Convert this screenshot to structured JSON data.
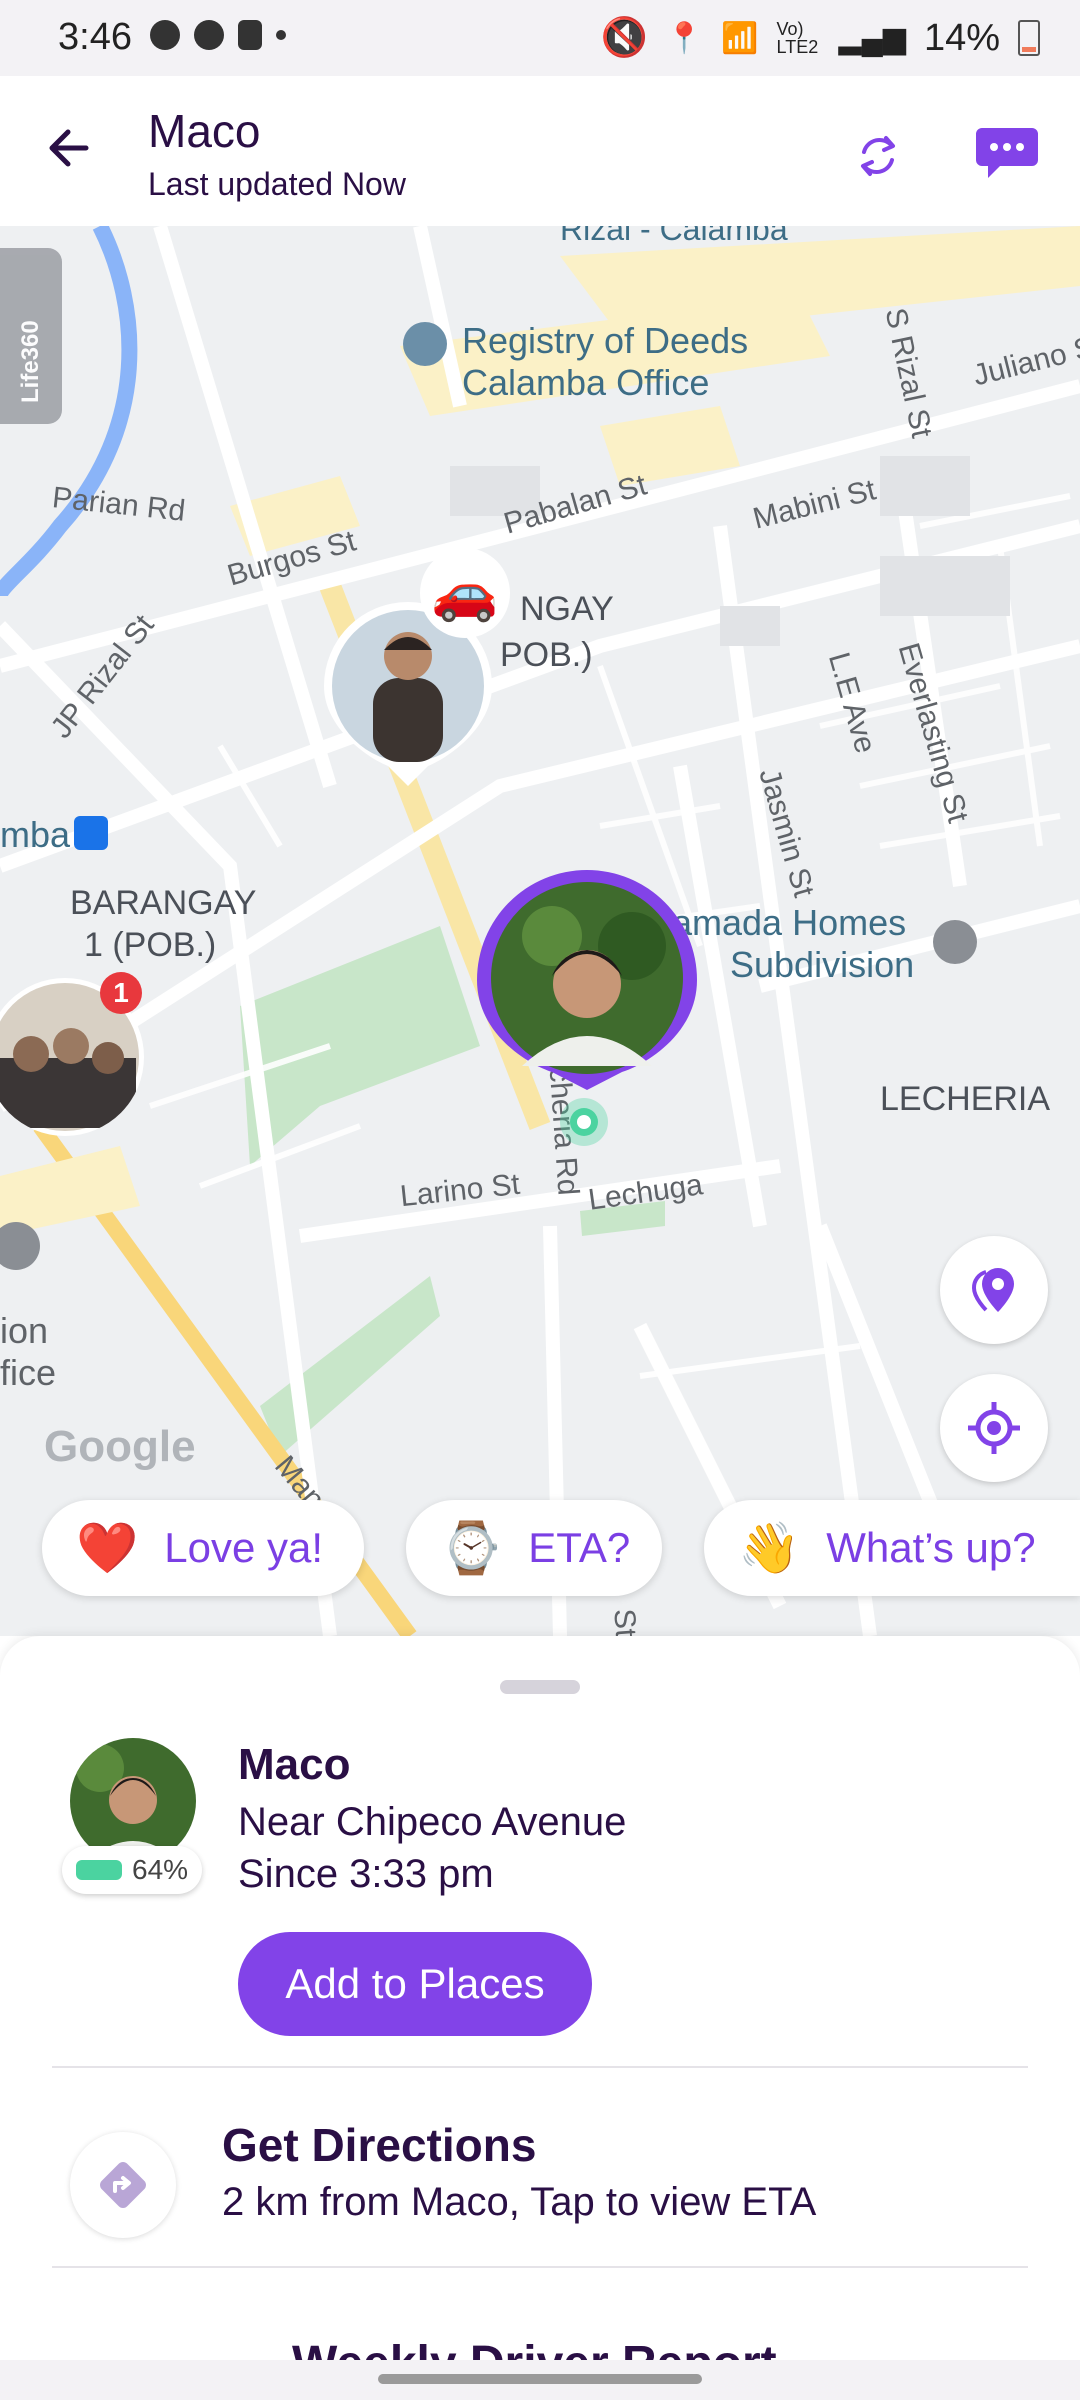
{
  "status_bar": {
    "time": "3:46",
    "network": "Vo) LTE2",
    "battery": "14%"
  },
  "header": {
    "title": "Maco",
    "subtitle": "Last updated Now"
  },
  "map": {
    "watermark": "Life360",
    "google": "Google",
    "labels": {
      "rizal_calamba": "Rizal - Calamba",
      "registry_1": "Registry of Deeds",
      "registry_2": "Calamba Office",
      "parian": "Parian Rd",
      "burgos": "Burgos St",
      "pabalan": "Pabalan St",
      "mabini": "Mabini St",
      "s_rizal": "S Rizal St",
      "juliano": "Juliano St",
      "barangay_top_1": "NGAY",
      "barangay_top_2": "POB.)",
      "jp_rizal": "JP Rizal St",
      "le_ave": "L.E Ave",
      "everlasting": "Everlasting St",
      "jasmin": "Jasmin St",
      "mba": "mba",
      "barangay1_1": "BARANGAY",
      "barangay1_2": "1 (POB.)",
      "homes_1": "amada Homes",
      "homes_2": "Subdivision",
      "lecheria": "LECHERIA",
      "lecheria_rd": "echeria Rd",
      "larino": "Larino St",
      "lechuga": "Lechuga",
      "ion": "ion",
      "fice": "fice",
      "man": "Man",
      "str": "St"
    },
    "badge_count": "1"
  },
  "chips": [
    {
      "emoji": "❤️",
      "label": "Love ya!"
    },
    {
      "emoji": "⌚",
      "label": "ETA?"
    },
    {
      "emoji": "👋",
      "label": "What’s up?"
    }
  ],
  "person": {
    "name": "Maco",
    "location": "Near Chipeco Avenue",
    "since": "Since 3:33 pm",
    "battery": "64%",
    "add_places": "Add to Places"
  },
  "directions": {
    "title": "Get Directions",
    "subtitle": "2 km from Maco, Tap to view ETA"
  },
  "weekly": "Weekly Driver Report",
  "colors": {
    "accent": "#8243e8",
    "text": "#2a0f45",
    "battery": "#4bd3a0"
  }
}
